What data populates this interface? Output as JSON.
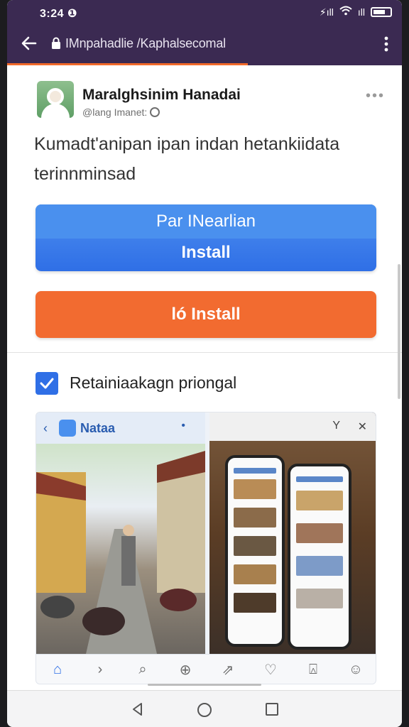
{
  "status_bar": {
    "time": "3:24 ❶",
    "signal": "⚡ıll",
    "wifi": "wifi",
    "cell": "ıll"
  },
  "browser": {
    "url": "IMnpahadlie /Kaphalsecomal",
    "back_icon": "back-arrow-icon",
    "menu_icon": "vertical-dots-icon",
    "progress_percent": 61,
    "colors": {
      "toolbar": "#3b2a52",
      "progress": "#f26a2a"
    }
  },
  "post": {
    "author_name": "Maralghsinim Hanadai",
    "author_handle": "@lang Imanet:",
    "text": "Kumadt'anipan ipan  indan hetankiidata terinnminsad"
  },
  "buttons": {
    "primary_top_label": "Par INearlian",
    "primary_bottom_label": "Install",
    "secondary_label": "ló  Install",
    "colors": {
      "primary": "#2f6fe6",
      "secondary": "#f26b30"
    }
  },
  "checkbox": {
    "checked": true,
    "label": "Retainiaakagn priongal"
  },
  "preview": {
    "title": "Nataa",
    "nav_icons": [
      "⌂",
      "›",
      "⌕",
      "⊕",
      "⇗",
      "♡",
      "⍓",
      "☺"
    ]
  }
}
